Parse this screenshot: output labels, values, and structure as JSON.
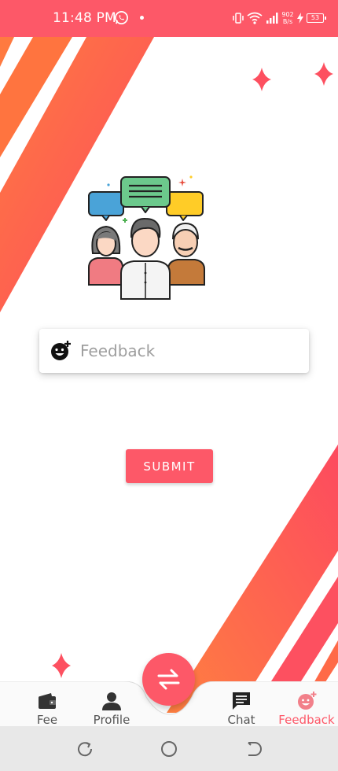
{
  "status_bar": {
    "time": "11:48 PM",
    "net_speed_value": "902",
    "net_speed_unit": "B/s",
    "battery": "53"
  },
  "feedback": {
    "placeholder": "Feedback",
    "value": ""
  },
  "submit_label": "SUBMIT",
  "bottom_nav": {
    "items": [
      {
        "label": "Fee",
        "icon": "wallet-icon"
      },
      {
        "label": "Profile",
        "icon": "person-icon"
      },
      {
        "label": "Chat",
        "icon": "chat-icon"
      },
      {
        "label": "Feedback",
        "icon": "add-emoji-icon",
        "active": true
      }
    ],
    "center_action_icon": "swap-arrows-icon"
  },
  "colors": {
    "accent": "#fd5868",
    "stripe_light": "#ff7a45",
    "stripe_dark": "#fd4a5f"
  }
}
